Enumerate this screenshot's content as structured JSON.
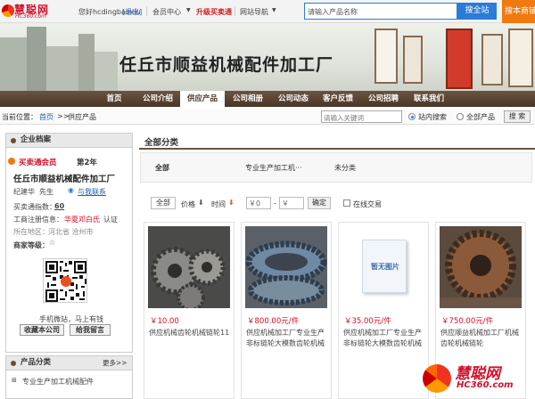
{
  "topbar": {
    "logo_main": "慧聪网",
    "logo_sub": "HC360.com",
    "welcome": "您好hcdingbaoxiu",
    "logout": "[退出]",
    "member_center": "会员中心",
    "upgrade": "升级买卖通",
    "site_nav": "网站导航",
    "search_placeholder": "请输入产品名称",
    "search_button": "搜全站",
    "find_button": "搜本商铺"
  },
  "banner": {
    "company_name": "任丘市顺益机械配件加工厂"
  },
  "nav": {
    "items": [
      "首页",
      "公司介绍",
      "供应产品",
      "公司相册",
      "公司动态",
      "客户反馈",
      "公司招聘",
      "联系我们"
    ],
    "active_index": 2
  },
  "breadcrumb": {
    "label": "当前位置：",
    "home": "首页",
    "sep": ">>",
    "current": "供应产品",
    "keyword_placeholder": "请输入关键词",
    "radio_site": "站内搜索",
    "radio_all": "全部产品",
    "search_button": "搜 索"
  },
  "sidebar": {
    "profile_title": "企业档案",
    "vip_label": "买卖通会员",
    "vip_years": "第2年",
    "company": "任丘市顺益机械配件加工厂",
    "contact_name": "纪建华",
    "contact_title": "先生",
    "contact_link": "与我联系",
    "index_label": "买卖通指数：",
    "index_value": "60",
    "registration_label": "工商注册信息：",
    "registration_value": "华夏邓白氏",
    "certified": "认证",
    "location_label": "所在地区：",
    "location_value": "河北省 沧州市",
    "rating_label": "商家等级：",
    "qr_caption": "手机微站，马上有钱",
    "favorite_button": "收藏本公司",
    "message_button": "给我留言",
    "category_title": "产品分类",
    "more": "更多>>",
    "category_items": [
      "专业生产加工机械配件"
    ]
  },
  "main": {
    "title": "全部分类",
    "categories": [
      "全部",
      "专业生产加工机···",
      "未分类"
    ],
    "filter": {
      "all": "全部",
      "price": "价格",
      "time": "时间",
      "price_min": "￥0",
      "price_max": "￥",
      "confirm": "确定",
      "online": "在线交易"
    },
    "products": [
      {
        "price": "￥10.00",
        "name": "供应机械齿轮机械链轮11",
        "has_image": true
      },
      {
        "price": "￥800.00元/件",
        "name": "供应机械加工厂专业生产非标链轮大模数齿轮机械",
        "has_image": true
      },
      {
        "price": "￥35.00元/件",
        "name": "供应机械加工厂专业生产非标链轮大模数齿轮机械",
        "has_image": false,
        "no_image_text": "暂无图片"
      },
      {
        "price": "￥750.00元/件",
        "name": "供应顺益机械加工厂机械齿轮机械链轮",
        "has_image": true
      }
    ]
  },
  "watermark": {
    "main": "慧聪网",
    "sub": "HC360.com"
  }
}
